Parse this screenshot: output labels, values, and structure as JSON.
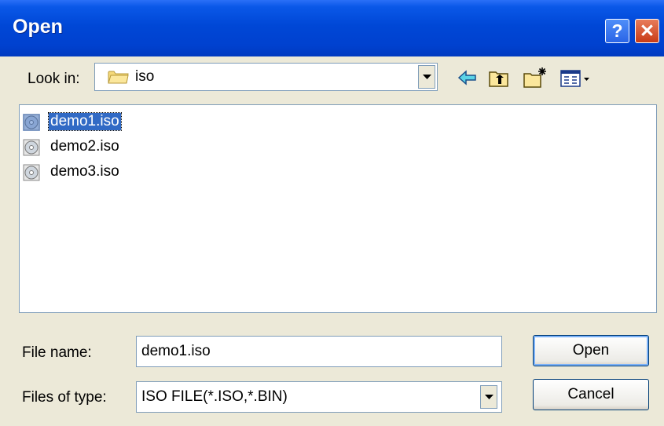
{
  "window": {
    "title": "Open",
    "help_glyph": "?",
    "close_glyph": "✕"
  },
  "lookin": {
    "label": "Look in:",
    "value": "iso",
    "icon": "folder-icon"
  },
  "toolbar": {
    "icons": [
      "back-arrow-icon",
      "up-folder-icon",
      "new-folder-icon",
      "view-menu-icon"
    ]
  },
  "files": [
    {
      "name": "demo1.iso",
      "icon": "disc-image-icon",
      "selected": true
    },
    {
      "name": "demo2.iso",
      "icon": "disc-image-icon",
      "selected": false
    },
    {
      "name": "demo3.iso",
      "icon": "disc-image-icon",
      "selected": false
    }
  ],
  "filename": {
    "label": "File name:",
    "value": "demo1.iso"
  },
  "filetype": {
    "label": "Files of type:",
    "value": "ISO FILE(*.ISO,*.BIN)"
  },
  "buttons": {
    "open": "Open",
    "cancel": "Cancel"
  },
  "colors": {
    "titlebar": "#0047d6",
    "selection": "#316ac5",
    "dialog_bg": "#ece9d8"
  }
}
